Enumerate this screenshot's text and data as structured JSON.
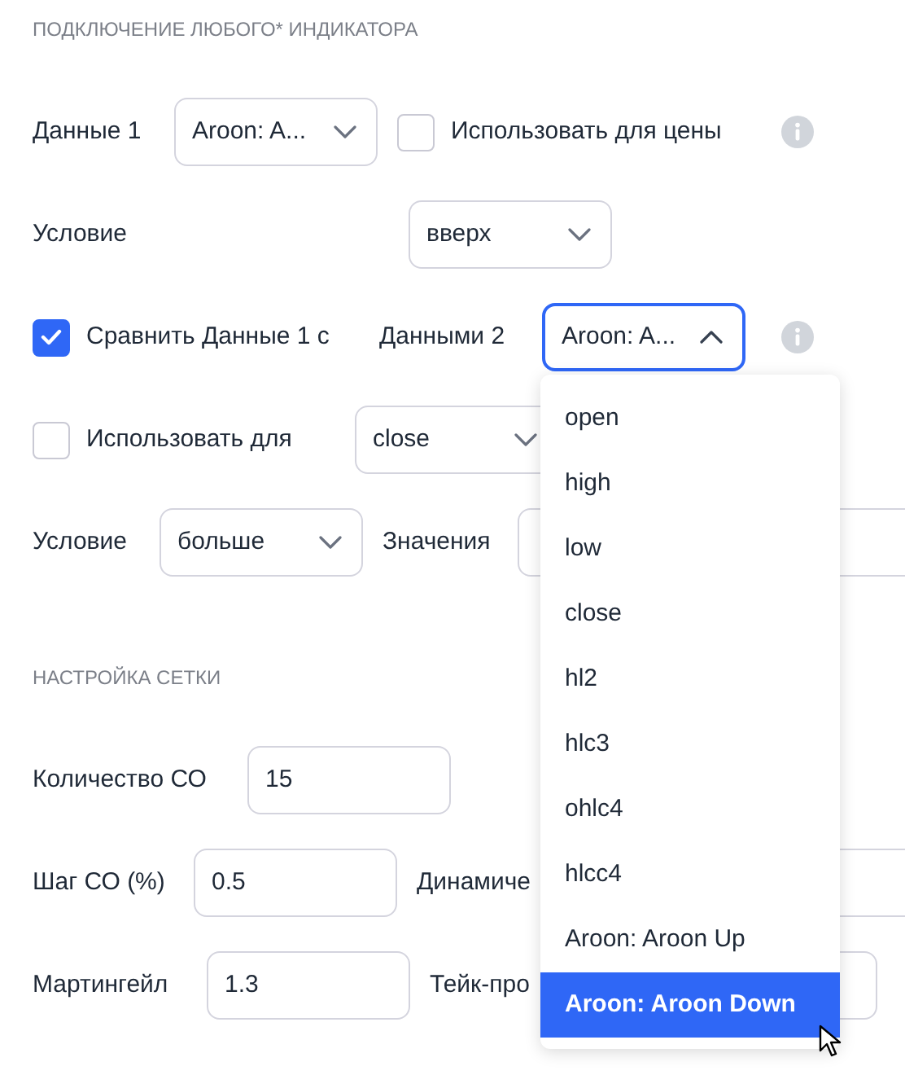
{
  "sections": [
    {
      "title": "ПОДКЛЮЧЕНИЕ ЛЮБОГО* ИНДИКАТОРА",
      "rows": [
        {
          "items": [
            {
              "kind": "label",
              "text": "Данные 1"
            },
            {
              "kind": "select",
              "value": "Aroon: A...",
              "open": false
            },
            {
              "kind": "checkbox",
              "checked": false,
              "text": "Использовать для цены"
            },
            {
              "kind": "info"
            }
          ]
        },
        {
          "items": [
            {
              "kind": "label",
              "text": "Условие"
            },
            {
              "kind": "select",
              "value": "вверх",
              "open": false
            }
          ]
        },
        {
          "items": [
            {
              "kind": "checkbox",
              "checked": true,
              "text": "Сравнить Данные 1 с"
            },
            {
              "kind": "label",
              "text": "Данными 2"
            },
            {
              "kind": "select",
              "value": "Aroon: A...",
              "open": true,
              "options": [
                {
                  "label": "open",
                  "selected": false
                },
                {
                  "label": "high",
                  "selected": false
                },
                {
                  "label": "low",
                  "selected": false
                },
                {
                  "label": "close",
                  "selected": false
                },
                {
                  "label": "hl2",
                  "selected": false
                },
                {
                  "label": "hlc3",
                  "selected": false
                },
                {
                  "label": "ohlc4",
                  "selected": false
                },
                {
                  "label": "hlcc4",
                  "selected": false
                },
                {
                  "label": "Aroon: Aroon Up",
                  "selected": false
                },
                {
                  "label": "Aroon: Aroon Down",
                  "selected": true
                }
              ]
            },
            {
              "kind": "info"
            }
          ]
        },
        {
          "items": [
            {
              "kind": "checkbox",
              "checked": false,
              "text": "Использовать для"
            },
            {
              "kind": "select",
              "value": "close",
              "open": false
            }
          ]
        },
        {
          "items": [
            {
              "kind": "label",
              "text": "Условие"
            },
            {
              "kind": "select",
              "value": "больше",
              "open": false
            },
            {
              "kind": "label",
              "text": "Значения"
            },
            {
              "kind": "input"
            }
          ]
        }
      ]
    },
    {
      "title": "НАСТРОЙКА СЕТКИ",
      "rows": [
        {
          "items": [
            {
              "kind": "label",
              "text": "Количество СО"
            },
            {
              "kind": "input",
              "value": "15"
            }
          ]
        },
        {
          "items": [
            {
              "kind": "label",
              "text": "Шаг СО (%)"
            },
            {
              "kind": "input",
              "value": "0.5"
            },
            {
              "kind": "label",
              "text": "Динамиче"
            },
            {
              "kind": "input"
            }
          ]
        },
        {
          "items": [
            {
              "kind": "label",
              "text": "Мартингейл"
            },
            {
              "kind": "input",
              "value": "1.3"
            },
            {
              "kind": "label",
              "text": "Тейк-про"
            },
            {
              "kind": "input"
            }
          ]
        }
      ]
    }
  ]
}
